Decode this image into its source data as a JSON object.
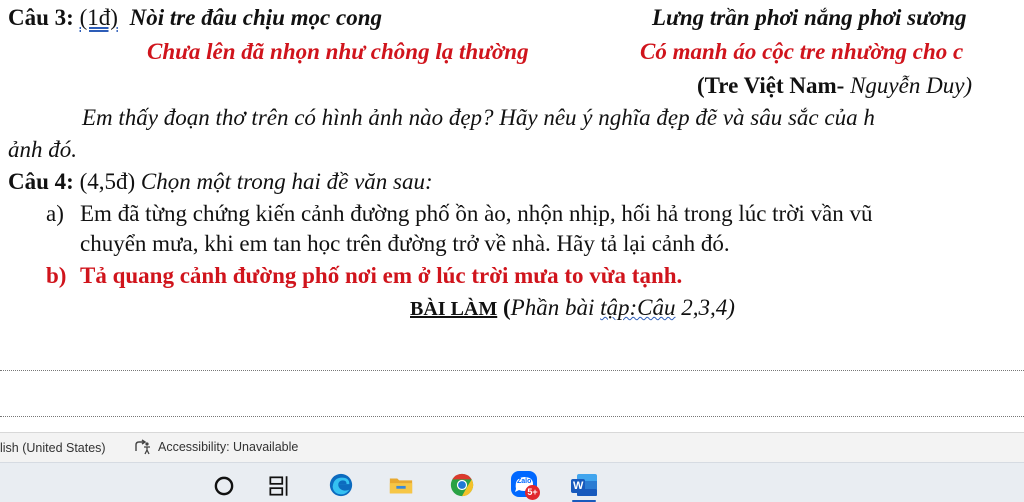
{
  "document": {
    "q3": {
      "label": "Câu 3:",
      "points": "(1đ)",
      "poem_line1_left": "Nòi tre đâu chịu mọc cong",
      "poem_line1_right": "Lưng trần phơi nắng phơi sương",
      "poem_line2_left": "Chưa lên đã nhọn như chông lạ thường",
      "poem_line2_right": "Có manh áo cộc tre nhường cho c",
      "source_bold": "(Tre Việt Nam-",
      "source_author": " Nguyễn Duy)",
      "question_line1": "Em thấy đoạn thơ trên có hình ảnh nào đẹp? Hãy nêu ý nghĩa đẹp đẽ và sâu sắc của h",
      "question_line2": "ảnh đó."
    },
    "q4": {
      "label": "Câu 4:",
      "points": "(4,5đ)",
      "instruction": " Chọn một trong hai đề văn sau:",
      "option_a_marker": "a)",
      "option_a_line1": "Em đã từng chứng kiến cảnh đường phố ồn ào, nhộn nhịp, hối hả trong lúc trời vần vũ",
      "option_a_line2": "chuyển mưa, khi em tan học trên đường trở về nhà. Hãy tả lại cảnh đó.",
      "option_b_marker": "b)",
      "option_b_text": "Tả quang cảnh đường phố nơi em ở lúc trời mưa to vừa tạnh."
    },
    "answer_heading": {
      "bold": "BÀI LÀM",
      "paren_open": " (",
      "italic_1": "Phần bài ",
      "italic_underlined": "tập:Câu",
      "italic_2": " 2,3,4)"
    }
  },
  "statusbar": {
    "language": "lish (United States)",
    "accessibility": "Accessibility: Unavailable"
  },
  "taskbar": {
    "zalo_badge": "5+",
    "zalo_text": "Zalo",
    "word_letter": "W"
  },
  "colors": {
    "red_text": "#d0141c",
    "word_blue": "#185abd",
    "edge_blue": "#0c6bbf",
    "chrome_green": "#2aa245",
    "zalo_blue": "#0068ff",
    "badge_red": "#e0282e"
  }
}
